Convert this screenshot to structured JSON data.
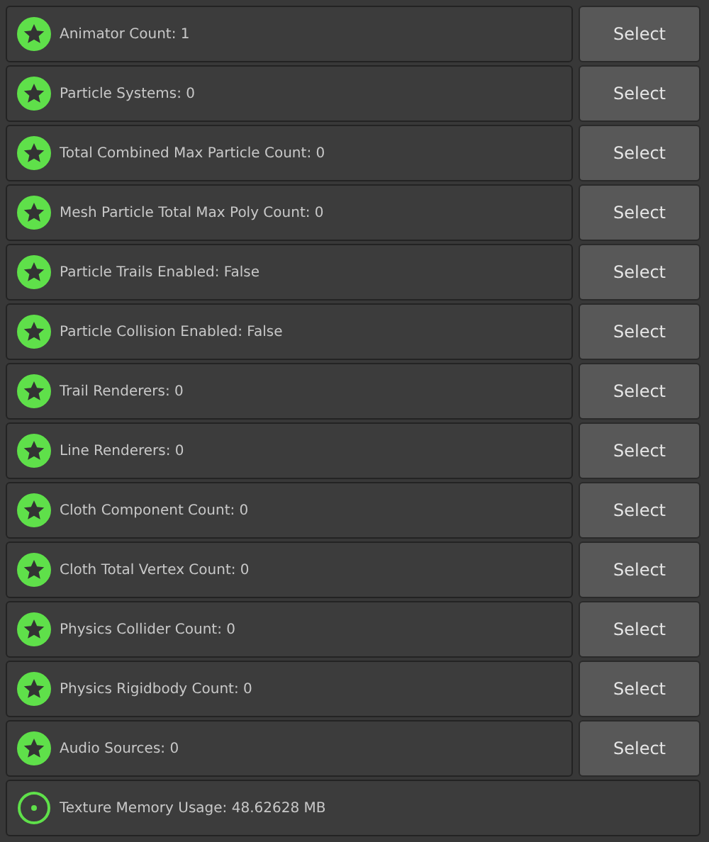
{
  "rows": [
    {
      "kind": "star",
      "label": "Animator Count: 1",
      "button": "Select"
    },
    {
      "kind": "star",
      "label": "Particle Systems: 0",
      "button": "Select"
    },
    {
      "kind": "star",
      "label": "Total Combined Max Particle Count: 0",
      "button": "Select"
    },
    {
      "kind": "star",
      "label": "Mesh Particle Total Max Poly Count: 0",
      "button": "Select"
    },
    {
      "kind": "star",
      "label": "Particle Trails Enabled: False",
      "button": "Select"
    },
    {
      "kind": "star",
      "label": "Particle Collision Enabled: False",
      "button": "Select"
    },
    {
      "kind": "star",
      "label": "Trail Renderers: 0",
      "button": "Select"
    },
    {
      "kind": "star",
      "label": "Line Renderers: 0",
      "button": "Select"
    },
    {
      "kind": "star",
      "label": "Cloth Component Count: 0",
      "button": "Select"
    },
    {
      "kind": "star",
      "label": "Cloth Total Vertex Count: 0",
      "button": "Select"
    },
    {
      "kind": "star",
      "label": "Physics Collider Count: 0",
      "button": "Select"
    },
    {
      "kind": "star",
      "label": "Physics Rigidbody Count: 0",
      "button": "Select"
    },
    {
      "kind": "star",
      "label": "Audio Sources: 0",
      "button": "Select"
    },
    {
      "kind": "dot",
      "label": "Texture Memory Usage: 48.62628 MB"
    }
  ]
}
